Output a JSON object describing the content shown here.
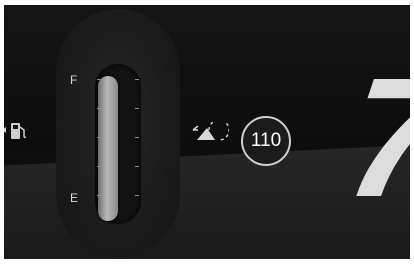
{
  "fuel_gauge": {
    "full_label": "F",
    "empty_label": "E",
    "level": 0.94,
    "icon": "fuel-pump-icon",
    "pointer_icon": "caret-left-icon"
  },
  "indicators": {
    "cruise_icon": "adaptive-cruise-icon"
  },
  "speed_limit": {
    "value": "110"
  },
  "speedometer": {
    "value": "7"
  },
  "colors": {
    "background": "#111111",
    "needle": "#b9b9b9",
    "text": "#dcdcdc"
  }
}
